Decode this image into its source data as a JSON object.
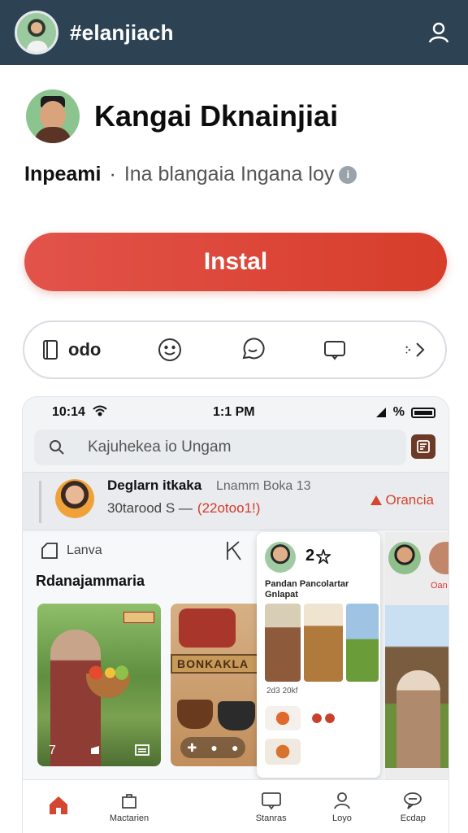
{
  "topbar": {
    "title": "#elanjiach",
    "avatar_icon": "avatar",
    "user_icon": "user-icon"
  },
  "app": {
    "name": "Kangai Dknainjiai",
    "developer": "Inpeami",
    "separator": "·",
    "description": "Ina blangaia Ingana loy",
    "info_icon": "info-icon",
    "install_label": "Instal",
    "install_color": "#d9412f"
  },
  "actions": {
    "first_label": "odo",
    "icons": [
      "document-icon",
      "smile-icon",
      "chat-icon",
      "comment-icon",
      "share-icon"
    ]
  },
  "screenshot": {
    "status": {
      "time_left": "10:14",
      "time_center": "1:1 PM",
      "signal": "%"
    },
    "search": {
      "placeholder": "Kajuhekea io Ungam"
    },
    "creator": {
      "name": "Deglarn itkaka",
      "meta": "Lnamm Boka 13",
      "line2_prefix": "30tarood S —",
      "line2_highlight": "(22otoo1!)",
      "badge": "Orancia"
    },
    "left_panel": {
      "label": "Lanva",
      "heading": "Rdanajammaria",
      "img1_ctrl_left": "7",
      "img2_sign": "BONKAKLA"
    },
    "card": {
      "count": "2",
      "title": "Pandan Pancolartar Gnlapat",
      "caption": "2d3 20kf"
    },
    "right_panel": {
      "label": "Oan"
    },
    "tabs": [
      {
        "label": "",
        "icon": "home-icon",
        "active": true
      },
      {
        "label": "Mactarien",
        "icon": "bag-icon",
        "active": false
      },
      {
        "label": "",
        "icon": "blank",
        "active": false
      },
      {
        "label": "Stanras",
        "icon": "chat-box-icon",
        "active": false
      },
      {
        "label": "Loyo",
        "icon": "person-icon",
        "active": false
      },
      {
        "label": "Ecdap",
        "icon": "message-icon",
        "active": false
      }
    ]
  }
}
